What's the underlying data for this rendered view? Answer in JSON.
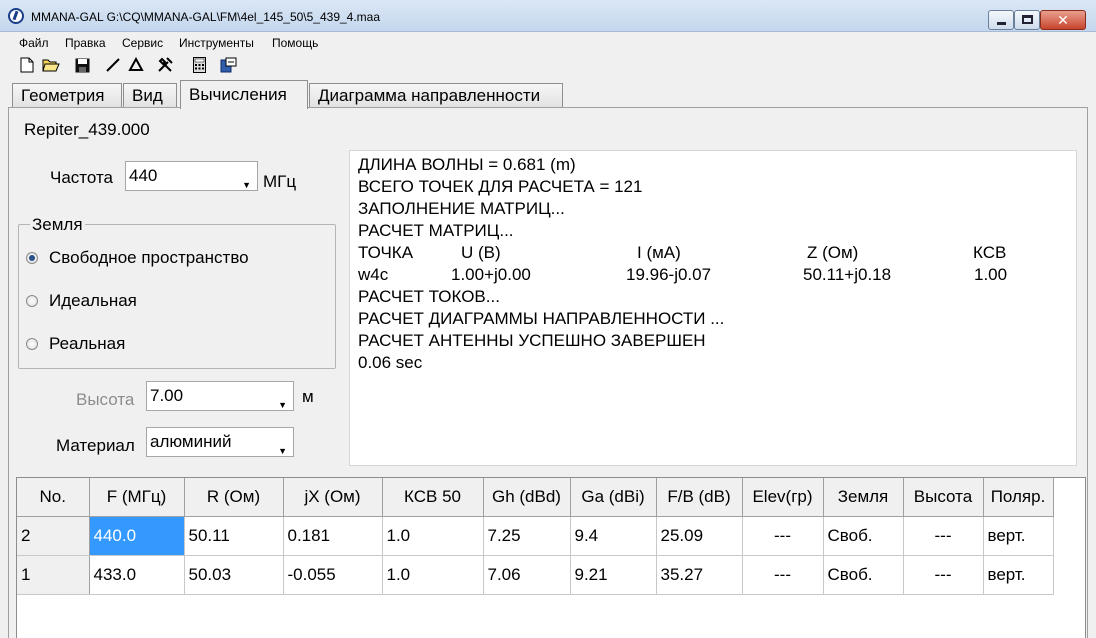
{
  "window": {
    "title": "MMANA-GAL G:\\CQ\\MMANA-GAL\\FM\\4el_145_50\\5_439_4.maa",
    "close_glyph": "✕"
  },
  "menu": [
    "Файл",
    "Правка",
    "Сервис",
    "Инструменты",
    "Помощь"
  ],
  "toolbar_icons": [
    "new-file-icon",
    "open-folder-icon",
    "save-icon",
    "line-tool-icon",
    "triangle-tool-icon",
    "tools-icon",
    "calculator-icon",
    "export-icon"
  ],
  "tabs": [
    {
      "label": "Геометрия",
      "active": false
    },
    {
      "label": "Вид",
      "active": false
    },
    {
      "label": "Вычисления",
      "active": true
    },
    {
      "label": "Диаграмма направленности",
      "active": false
    }
  ],
  "project_name": "Repiter_439.000",
  "frequency": {
    "label": "Частота",
    "value": "440",
    "unit": "МГц"
  },
  "ground": {
    "group_label": "Земля",
    "options": [
      {
        "label": "Свободное пространство",
        "checked": true
      },
      {
        "label": "Идеальная",
        "checked": false
      },
      {
        "label": "Реальная",
        "checked": false
      }
    ]
  },
  "height": {
    "label": "Высота",
    "value": "7.00",
    "unit": "м"
  },
  "material": {
    "label": "Материал",
    "value": "алюминий"
  },
  "output": {
    "lines_top": [
      "ДЛИНА ВОЛНЫ = 0.681 (m)",
      "ВСЕГО ТОЧЕК ДЛЯ РАСЧЕТА = 121",
      "ЗАПОЛНЕНИЕ МАТРИЦ...",
      "РАСЧЕТ МАТРИЦ..."
    ],
    "table_header": [
      "ТОЧКА",
      "U (B)",
      "I (мА)",
      "Z (Ом)",
      "КСВ"
    ],
    "table_row": [
      "w4c",
      "1.00+j0.00",
      "19.96-j0.07",
      "50.11+j0.18",
      "1.00"
    ],
    "lines_bottom": [
      "РАСЧЕТ ТОКОВ...",
      "РАСЧЕТ ДИАГРАММЫ НАПРАВЛЕННОСТИ ...",
      "РАСЧЕТ АНТЕННЫ УСПЕШНО ЗАВЕРШЕН",
      "0.06 sec"
    ]
  },
  "results": {
    "columns": [
      "No.",
      "F (МГц)",
      "R (Ом)",
      "jX (Ом)",
      "КСВ 50",
      "Gh (dBd)",
      "Ga (dBi)",
      "F/B (dB)",
      "Elev(гр)",
      "Земля",
      "Высота",
      "Поляр."
    ],
    "rows": [
      [
        "2",
        "440.0",
        "50.11",
        "0.181",
        "1.0",
        "7.25",
        "9.4",
        "25.09",
        "---",
        "Своб.",
        "---",
        "верт."
      ],
      [
        "1",
        "433.0",
        "50.03",
        "-0.055",
        "1.0",
        "7.06",
        "9.21",
        "35.27",
        "---",
        "Своб.",
        "---",
        "верт."
      ]
    ]
  }
}
